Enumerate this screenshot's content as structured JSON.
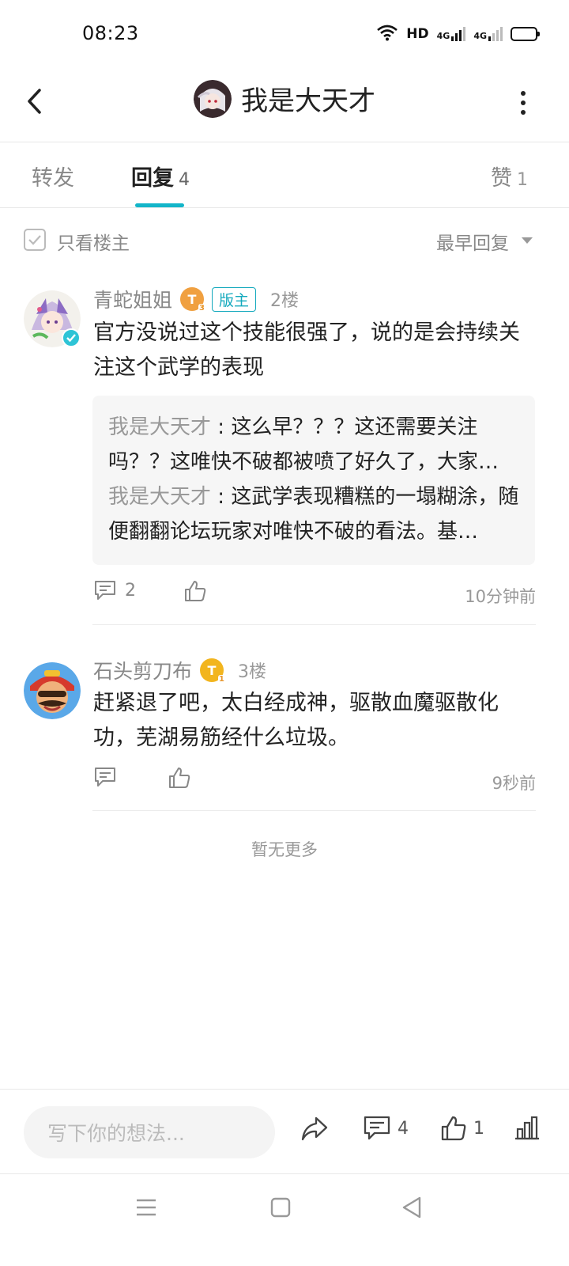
{
  "status_bar": {
    "time": "08:23",
    "network_label": "HD",
    "sim1": "4G",
    "sim2": "4G"
  },
  "header": {
    "title": "我是大天才"
  },
  "tabs": {
    "forward": {
      "label": "转发"
    },
    "reply": {
      "label": "回复",
      "count": "4"
    },
    "like": {
      "label": "赞",
      "count": "1"
    }
  },
  "filter": {
    "only_op_label": "只看楼主",
    "sort_label": "最早回复"
  },
  "comments": [
    {
      "name": "青蛇姐姐",
      "level": "T",
      "level_sub": "3",
      "role_tag": "版主",
      "floor": "2楼",
      "text": "官方没说过这个技能很强了，说的是会持续关注这个武学的表现",
      "replies": [
        {
          "name": "我是大天才",
          "sep": " : ",
          "text": "这么早？？？这还需要关注吗？？这唯快不破都被喷了好久了，大家…"
        },
        {
          "name": "我是大天才",
          "sep": " : ",
          "text": "这武学表现糟糕的一塌糊涂，随便翻翻论坛玩家对唯快不破的看法。基…"
        }
      ],
      "comment_count": "2",
      "time": "10分钟前"
    },
    {
      "name": "石头剪刀布",
      "level": "T",
      "level_sub": "1",
      "floor": "3楼",
      "text": "赶紧退了吧，太白经成神，驱散血魔驱散化功，芜湖易筋经什么垃圾。",
      "time": "9秒前"
    }
  ],
  "no_more": "暂无更多",
  "bottom_bar": {
    "input_placeholder": "写下你的想法...",
    "comment_count": "4",
    "like_count": "1"
  },
  "colors": {
    "accent": "#13b5c9",
    "level_orange": "#f0a040",
    "level_gold": "#f2b51e"
  }
}
